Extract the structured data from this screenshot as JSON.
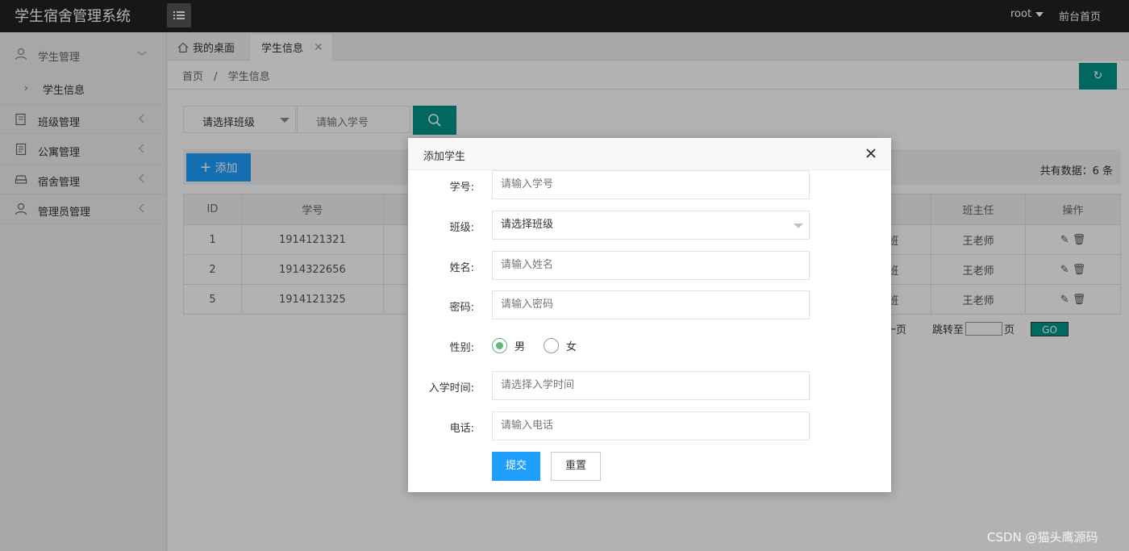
{
  "app": {
    "title": "学生宿舍管理系统"
  },
  "topbar": {
    "user": "root",
    "front_link": "前台首页"
  },
  "sidebar": {
    "items": [
      {
        "label": "学生管理",
        "icon": "user-icon",
        "expanded": true
      },
      {
        "label": "班级管理",
        "icon": "class-icon"
      },
      {
        "label": "公寓管理",
        "icon": "apartment-icon"
      },
      {
        "label": "宿舍管理",
        "icon": "dorm-icon"
      },
      {
        "label": "管理员管理",
        "icon": "admin-icon"
      }
    ],
    "sub_item": "学生信息"
  },
  "tabs": {
    "home": "我的桌面",
    "active": "学生信息"
  },
  "breadcrumb": {
    "home": "首页",
    "sep": "/",
    "current": "学生信息"
  },
  "filter": {
    "class_select": "请选择班级",
    "student_no_placeholder": "请输入学号"
  },
  "toolbar": {
    "add_label": "添加",
    "total": "共有数据：6 条"
  },
  "table": {
    "headers": [
      "ID",
      "学号",
      "",
      "",
      "",
      "",
      "",
      "",
      "",
      "班主任",
      "操作"
    ],
    "rows": [
      {
        "id": "1",
        "no": "1914121321",
        "class": "班",
        "teacher": "王老师"
      },
      {
        "id": "2",
        "no": "1914322656",
        "class": "班",
        "teacher": "王老师"
      },
      {
        "id": "5",
        "no": "1914121325",
        "class": "班",
        "teacher": "王老师"
      }
    ]
  },
  "pager": {
    "prev_fragment": "一页",
    "jump_to": "跳转至",
    "page_unit": "页",
    "go": "GO"
  },
  "modal": {
    "title": "添加学生",
    "fields": {
      "student_no": {
        "label": "学号:",
        "placeholder": "请输入学号"
      },
      "class": {
        "label": "班级:",
        "value": "请选择班级"
      },
      "name": {
        "label": "姓名:",
        "placeholder": "请输入姓名"
      },
      "password": {
        "label": "密码:",
        "placeholder": "请输入密码"
      },
      "gender": {
        "label": "性别:",
        "options": [
          "男",
          "女"
        ],
        "selected": "男"
      },
      "enroll_time": {
        "label": "入学时间:",
        "placeholder": "请选择入学时间"
      },
      "phone": {
        "label": "电话:",
        "placeholder": "请输入电话"
      }
    },
    "submit": "提交",
    "reset": "重置"
  },
  "watermark": "CSDN @猫头鹰源码",
  "colors": {
    "primary": "#009688",
    "blue": "#1e9fff",
    "topbar": "#222222",
    "radio": "#5fb878"
  }
}
